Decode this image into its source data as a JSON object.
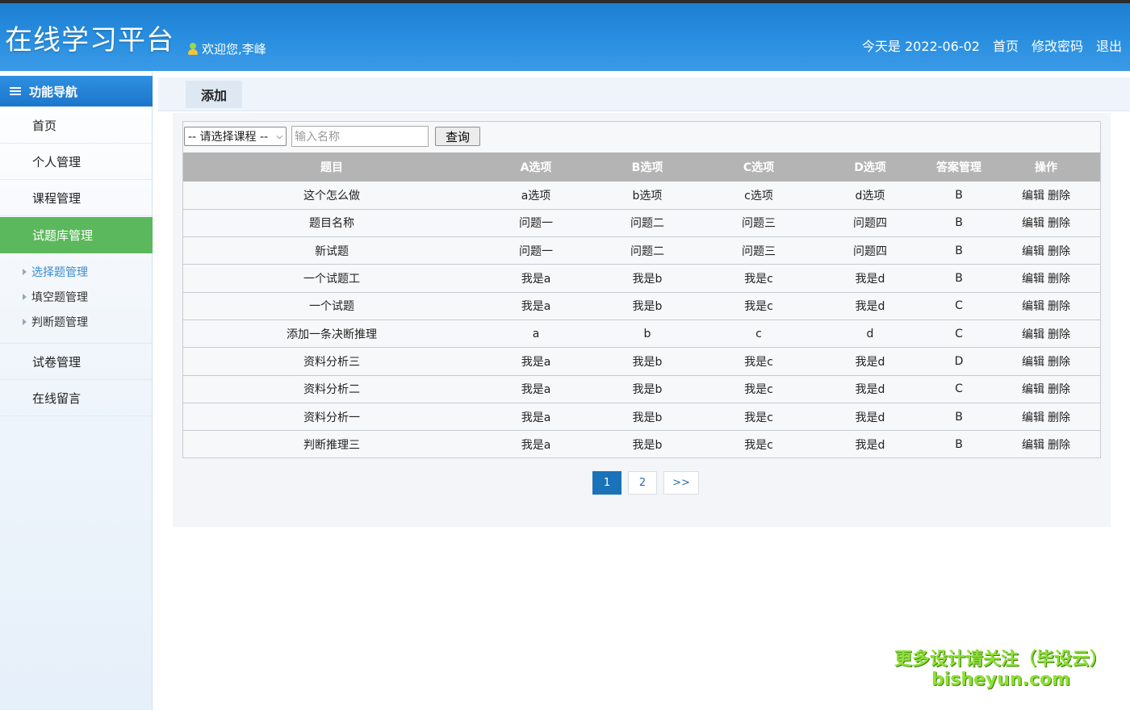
{
  "header": {
    "title": "在线学习平台",
    "welcome": "欢迎您,李峰",
    "date_text": "今天是 2022-06-02",
    "links": [
      "首页",
      "修改密码",
      "退出"
    ]
  },
  "sidebar": {
    "title": "功能导航",
    "items": [
      "首页",
      "个人管理",
      "课程管理",
      "试题库管理"
    ],
    "active_item": "试题库管理",
    "sub_items": [
      "选择题管理",
      "填空题管理",
      "判断题管理"
    ],
    "current_sub_item": "选择题管理",
    "items_after": [
      "试卷管理",
      "在线留言"
    ]
  },
  "tabs": {
    "active": "添加"
  },
  "toolbar": {
    "course_select": "-- 请选择课程 --",
    "search_placeholder": "输入名称",
    "search_value": "",
    "query_label": "查询"
  },
  "table": {
    "columns": [
      "题目",
      "A选项",
      "B选项",
      "C选项",
      "D选项",
      "答案管理",
      "操作"
    ],
    "rows": [
      {
        "title": "这个怎么做",
        "a": "a选项",
        "b": "b选项",
        "c": "c选项",
        "d": "d选项",
        "answer": "B"
      },
      {
        "title": "题目名称",
        "a": "问题一",
        "b": "问题二",
        "c": "问题三",
        "d": "问题四",
        "answer": "B"
      },
      {
        "title": "新试题",
        "a": "问题一",
        "b": "问题二",
        "c": "问题三",
        "d": "问题四",
        "answer": "B"
      },
      {
        "title": "一个试题工",
        "a": "我是a",
        "b": "我是b",
        "c": "我是c",
        "d": "我是d",
        "answer": "B"
      },
      {
        "title": "一个试题",
        "a": "我是a",
        "b": "我是b",
        "c": "我是c",
        "d": "我是d",
        "answer": "C"
      },
      {
        "title": "添加一条决断推理",
        "a": "a",
        "b": "b",
        "c": "c",
        "d": "d",
        "answer": "C"
      },
      {
        "title": "资料分析三",
        "a": "我是a",
        "b": "我是b",
        "c": "我是c",
        "d": "我是d",
        "answer": "D"
      },
      {
        "title": "资料分析二",
        "a": "我是a",
        "b": "我是b",
        "c": "我是c",
        "d": "我是d",
        "answer": "C"
      },
      {
        "title": "资料分析一",
        "a": "我是a",
        "b": "我是b",
        "c": "我是c",
        "d": "我是d",
        "answer": "B"
      },
      {
        "title": "判断推理三",
        "a": "我是a",
        "b": "我是b",
        "c": "我是c",
        "d": "我是d",
        "answer": "B"
      }
    ],
    "edit_label": "编辑",
    "delete_label": "删除"
  },
  "pagination": {
    "pages": [
      "1",
      "2"
    ],
    "current": "1",
    "next_label": ">>"
  },
  "watermark": {
    "line1": "更多设计请关注（毕设云）",
    "line2": "bisheyun.com"
  },
  "colors": {
    "header_blue": "#2a8fe0",
    "active_green": "#5cb85c",
    "table_header_gray": "#b4b4b4",
    "pager_current": "#1a72b8"
  }
}
